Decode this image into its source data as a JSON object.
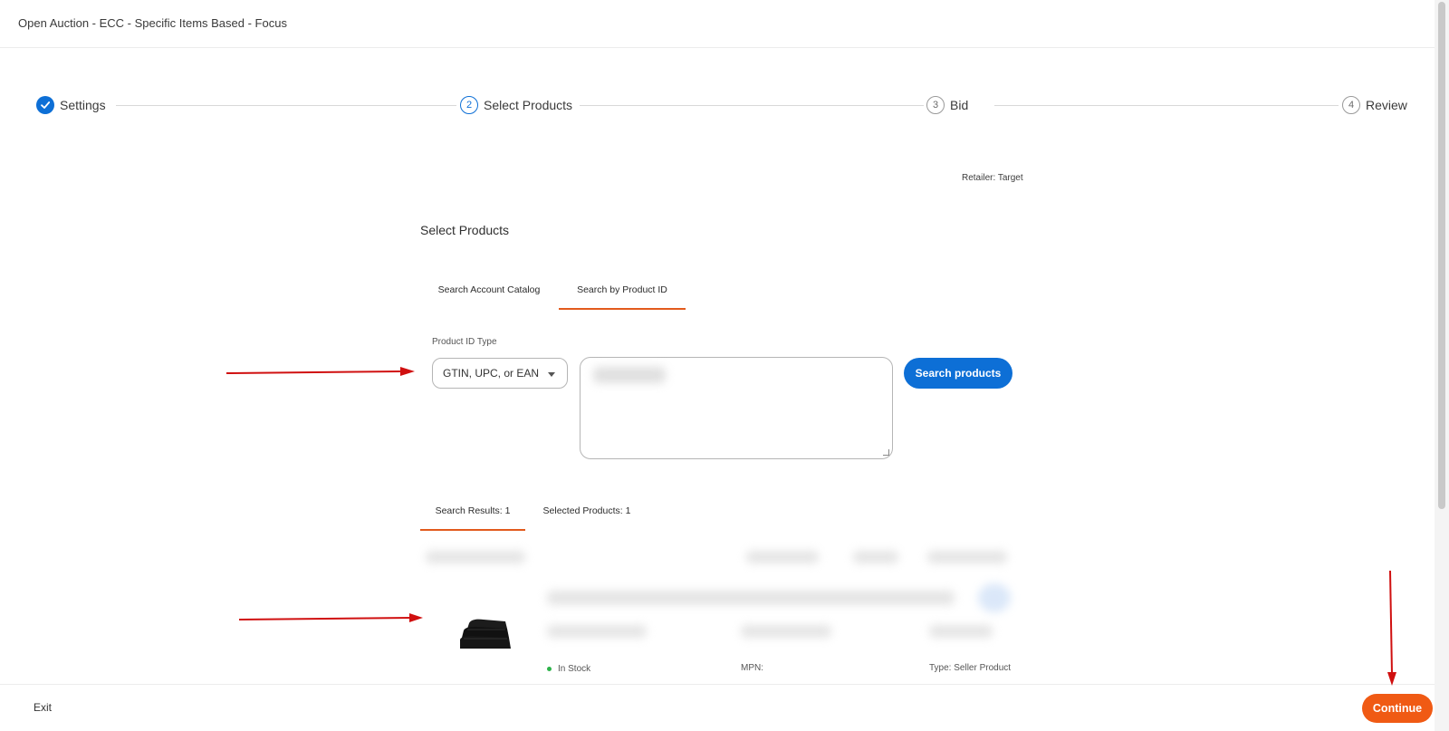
{
  "header": {
    "title": "Open Auction - ECC - Specific Items Based - Focus"
  },
  "stepper": {
    "steps": [
      {
        "number": "",
        "label": "Settings",
        "state": "done"
      },
      {
        "number": "2",
        "label": "Select Products",
        "state": "active"
      },
      {
        "number": "3",
        "label": "Bid",
        "state": "todo"
      },
      {
        "number": "4",
        "label": "Review",
        "state": "todo"
      }
    ]
  },
  "retailer": "Retailer: Target",
  "main": {
    "title": "Select Products",
    "search_tabs": [
      "Search Account Catalog",
      "Search by Product ID"
    ],
    "active_search_tab": "Search by Product ID",
    "product_id_type_label": "Product ID Type",
    "product_id_type_value": "GTIN, UPC, or EAN",
    "search_button": "Search products",
    "result_tabs": [
      "Search Results: 1",
      "Selected Products: 1"
    ],
    "active_result_tab": "Search Results: 1",
    "result": {
      "stock": "In Stock",
      "mpn": "MPN:",
      "type": "Type: Seller Product"
    }
  },
  "footer": {
    "exit": "Exit",
    "continue": "Continue"
  },
  "colors": {
    "primary_blue": "#0d6fd6",
    "accent_orange": "#f05a14",
    "tab_underline": "#e25a1c",
    "annotation_red": "#d01010"
  }
}
